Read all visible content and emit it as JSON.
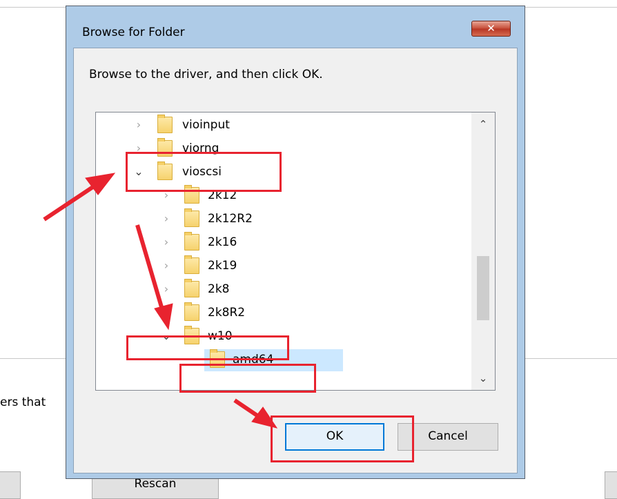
{
  "background": {
    "partial_text": "ers that",
    "rescan_label": "Rescan"
  },
  "dialog": {
    "title": "Browse for Folder",
    "close_label": "✕",
    "instruction": "Browse to the driver, and then click OK.",
    "tree": [
      {
        "label": "vioinput",
        "level": 0,
        "expanded": false
      },
      {
        "label": "viorng",
        "level": 0,
        "expanded": false
      },
      {
        "label": "vioscsi",
        "level": 0,
        "expanded": true
      },
      {
        "label": "2k12",
        "level": 1,
        "expanded": false
      },
      {
        "label": "2k12R2",
        "level": 1,
        "expanded": false
      },
      {
        "label": "2k16",
        "level": 1,
        "expanded": false
      },
      {
        "label": "2k19",
        "level": 1,
        "expanded": false
      },
      {
        "label": "2k8",
        "level": 1,
        "expanded": false
      },
      {
        "label": "2k8R2",
        "level": 1,
        "expanded": false
      },
      {
        "label": "w10",
        "level": 1,
        "expanded": true
      },
      {
        "label": "amd64",
        "level": 2,
        "expanded": false,
        "selected": true
      }
    ],
    "ok_label": "OK",
    "cancel_label": "Cancel"
  },
  "colors": {
    "annotation": "#e8232f",
    "selection": "#cce8ff",
    "accent": "#0078d7"
  }
}
